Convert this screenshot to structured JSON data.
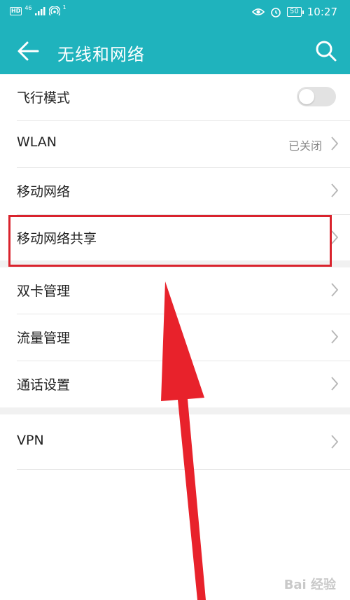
{
  "status_bar": {
    "hd": "HD",
    "net": "46",
    "sup": "1",
    "battery": "50",
    "time": "10:27"
  },
  "header": {
    "title": "无线和网络"
  },
  "items": [
    {
      "label": "飞行模式"
    },
    {
      "label": "WLAN",
      "value": "已关闭"
    },
    {
      "label": "移动网络"
    },
    {
      "label": "移动网络共享"
    },
    {
      "label": "双卡管理"
    },
    {
      "label": "流量管理"
    },
    {
      "label": "通话设置"
    },
    {
      "label": "VPN"
    }
  ],
  "airplane_toggle_on": false,
  "watermark": "Bai 经验",
  "colors": {
    "accent": "#1fb3bd",
    "annotation": "#d9232d"
  }
}
